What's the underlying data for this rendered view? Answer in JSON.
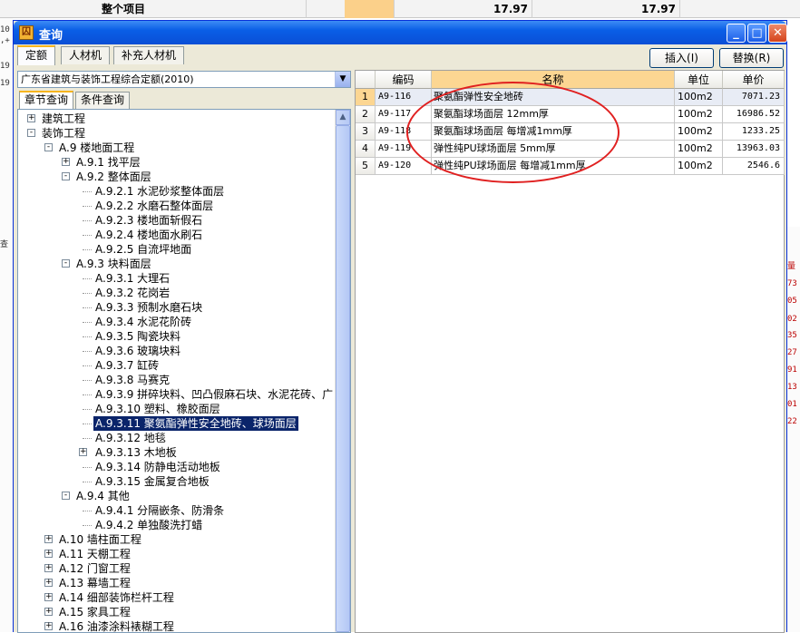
{
  "background": {
    "header_label": "整个项目",
    "header_values": [
      "17.97",
      "17.97"
    ],
    "left_fragments": [
      "10",
      ",+",
      "19",
      "19",
      "查"
    ],
    "right_fragments": [
      "量",
      "73",
      "05",
      "02",
      "35",
      "27",
      "91",
      "13",
      "01",
      "22"
    ]
  },
  "window": {
    "title": "查询",
    "minimize": "_",
    "maximize": "□",
    "close": "✕"
  },
  "tabs": [
    "定额",
    "人材机",
    "补充人材机"
  ],
  "buttons": {
    "insert": "插入(I)",
    "replace": "替换(R)"
  },
  "quota_library": "广东省建筑与装饰工程综合定额(2010)",
  "subtabs": [
    "章节查询",
    "条件查询"
  ],
  "tree": [
    {
      "label": "建筑工程",
      "level": 0,
      "expander": "+"
    },
    {
      "label": "装饰工程",
      "level": 0,
      "expander": "-"
    },
    {
      "label": "A.9 楼地面工程",
      "level": 1,
      "expander": "-"
    },
    {
      "label": "A.9.1 找平层",
      "level": 2,
      "expander": "+"
    },
    {
      "label": "A.9.2 整体面层",
      "level": 2,
      "expander": "-"
    },
    {
      "label": "A.9.2.1 水泥砂浆整体面层",
      "level": 3
    },
    {
      "label": "A.9.2.2 水磨石整体面层",
      "level": 3
    },
    {
      "label": "A.9.2.3 楼地面斩假石",
      "level": 3
    },
    {
      "label": "A.9.2.4 楼地面水刷石",
      "level": 3
    },
    {
      "label": "A.9.2.5 自流坪地面",
      "level": 3
    },
    {
      "label": "A.9.3 块料面层",
      "level": 2,
      "expander": "-"
    },
    {
      "label": "A.9.3.1 大理石",
      "level": 3
    },
    {
      "label": "A.9.3.2 花岗岩",
      "level": 3
    },
    {
      "label": "A.9.3.3 预制水磨石块",
      "level": 3
    },
    {
      "label": "A.9.3.4 水泥花阶砖",
      "level": 3
    },
    {
      "label": "A.9.3.5 陶瓷块料",
      "level": 3
    },
    {
      "label": "A.9.3.6 玻璃块料",
      "level": 3
    },
    {
      "label": "A.9.3.7 缸砖",
      "level": 3
    },
    {
      "label": "A.9.3.8 马赛克",
      "level": 3
    },
    {
      "label": "A.9.3.9 拼碎块料、凹凸假麻石块、水泥花砖、广",
      "level": 3
    },
    {
      "label": "A.9.3.10 塑料、橡胶面层",
      "level": 3
    },
    {
      "label": "A.9.3.11 聚氨酯弹性安全地砖、球场面层",
      "level": 3,
      "selected": true
    },
    {
      "label": "A.9.3.12 地毯",
      "level": 3
    },
    {
      "label": "A.9.3.13 木地板",
      "level": 3,
      "expander": "+"
    },
    {
      "label": "A.9.3.14 防静电活动地板",
      "level": 3
    },
    {
      "label": "A.9.3.15 金属复合地板",
      "level": 3
    },
    {
      "label": "A.9.4 其他",
      "level": 2,
      "expander": "-"
    },
    {
      "label": "A.9.4.1 分隔嵌条、防滑条",
      "level": 3
    },
    {
      "label": "A.9.4.2 单独酸洗打蜡",
      "level": 3
    },
    {
      "label": "A.10 墙柱面工程",
      "level": 1,
      "expander": "+"
    },
    {
      "label": "A.11 天棚工程",
      "level": 1,
      "expander": "+"
    },
    {
      "label": "A.12 门窗工程",
      "level": 1,
      "expander": "+"
    },
    {
      "label": "A.13 幕墙工程",
      "level": 1,
      "expander": "+"
    },
    {
      "label": "A.14 细部装饰栏杆工程",
      "level": 1,
      "expander": "+"
    },
    {
      "label": "A.15 家具工程",
      "level": 1,
      "expander": "+"
    },
    {
      "label": "A.16 油漆涂料裱糊工程",
      "level": 1,
      "expander": "+"
    }
  ],
  "table": {
    "headers": [
      "编码",
      "名称",
      "单位",
      "单价"
    ],
    "rows": [
      {
        "no": "1",
        "code": "A9-116",
        "name": "聚氨酯弹性安全地砖",
        "unit": "100m2",
        "price": "7071.23"
      },
      {
        "no": "2",
        "code": "A9-117",
        "name": "聚氨酯球场面层 12mm厚",
        "unit": "100m2",
        "price": "16986.52"
      },
      {
        "no": "3",
        "code": "A9-118",
        "name": "聚氨酯球场面层 每增减1mm厚",
        "unit": "100m2",
        "price": "1233.25"
      },
      {
        "no": "4",
        "code": "A9-119",
        "name": "弹性纯PU球场面层 5mm厚",
        "unit": "100m2",
        "price": "13963.03"
      },
      {
        "no": "5",
        "code": "A9-120",
        "name": "弹性纯PU球场面层 每增减1mm厚",
        "unit": "100m2",
        "price": "2546.6"
      }
    ]
  },
  "colors": {
    "annotation_circle": "#e02020",
    "selection": "#0a246a",
    "title_bar": "#0a5ee6"
  }
}
